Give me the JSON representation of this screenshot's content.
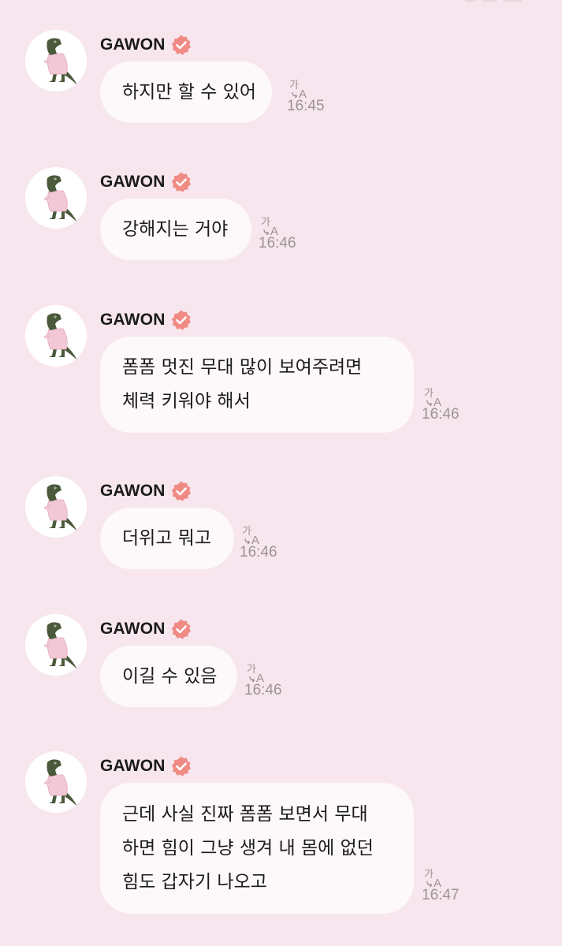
{
  "chat": {
    "messages": [
      {
        "sender": "GAWON",
        "lines": [
          "하지만 할 수 있어"
        ],
        "time": "16:45",
        "translate_icon": "translate-icon",
        "verified_icon": "verified-badge-icon"
      },
      {
        "sender": "GAWON",
        "lines": [
          "강해지는 거야"
        ],
        "time": "16:46",
        "translate_icon": "translate-icon",
        "verified_icon": "verified-badge-icon"
      },
      {
        "sender": "GAWON",
        "lines": [
          "폼폼 멋진 무대 많이 보여주려면",
          "체력 키워야 해서"
        ],
        "time": "16:46",
        "translate_icon": "translate-icon",
        "verified_icon": "verified-badge-icon"
      },
      {
        "sender": "GAWON",
        "lines": [
          "더위고 뭐고"
        ],
        "time": "16:46",
        "translate_icon": "translate-icon",
        "verified_icon": "verified-badge-icon"
      },
      {
        "sender": "GAWON",
        "lines": [
          "이길 수 있음"
        ],
        "time": "16:46",
        "translate_icon": "translate-icon",
        "verified_icon": "verified-badge-icon"
      },
      {
        "sender": "GAWON",
        "lines": [
          "근데 사실 진짜 폼폼 보면서 무대",
          "하면 힘이 그냥 생겨 내 몸에 없던",
          "힘도 갑자기 나오고"
        ],
        "time": "16:47",
        "translate_icon": "translate-icon",
        "verified_icon": "verified-badge-icon"
      }
    ]
  },
  "colors": {
    "background": "#f7e6ee",
    "bubble": "#fdf8fa",
    "verified_badge": "#f08a85",
    "time_text": "#9c9397"
  }
}
